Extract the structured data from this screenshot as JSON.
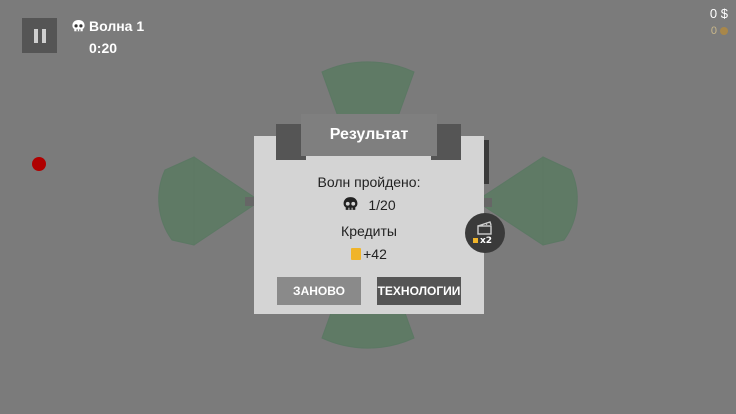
{
  "hud": {
    "wave_label": "Волна 1",
    "timer": "0:20",
    "money": "0 $",
    "credits": "0"
  },
  "dialog": {
    "title": "Результат",
    "waves_label": "Волн пройдено:",
    "waves_value": "1/20",
    "credits_label": "Кредиты",
    "credits_value": "+42",
    "retry_button": "ЗАНОВО",
    "tech_button": "ТЕХНОЛОГИИ"
  },
  "ad_bonus": {
    "multiplier": "x2"
  },
  "colors": {
    "background": "#7b7b7b",
    "zone": "#5f7a65",
    "panel": "#d4d4d4",
    "enemy": "#b00000",
    "coin": "#f0b429"
  },
  "icons": [
    "pause-icon",
    "skull-icon",
    "credit-coin-icon",
    "clapperboard-icon"
  ]
}
